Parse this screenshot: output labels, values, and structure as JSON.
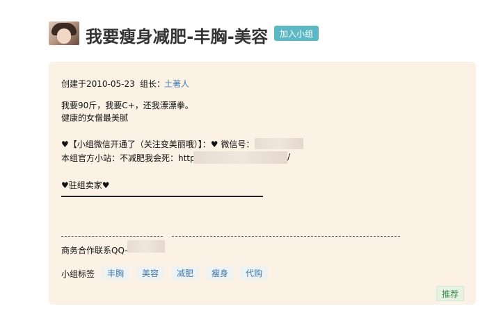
{
  "group": {
    "title": "我要瘦身减肥-丰胸-美容",
    "join_label": "加入小组"
  },
  "info": {
    "created": "创建于2010-05-23",
    "leader_label": "组长：",
    "leader_name": "土著人"
  },
  "description": {
    "line1": "我要90斤，我要C+，还我漂漂拳。",
    "line2": "健康的女僧最美腻",
    "line3": "♥【小组微信开通了（关注变美丽哦）】：♥ 微信号：",
    "line4": "本组官方小站：不减肥我会死：http:",
    "line4_tail": "/",
    "line5": "♥驻组卖家♥",
    "business": "商务合作联系QQ-"
  },
  "tags": {
    "label": "小组标签",
    "items": [
      "丰胸",
      "美容",
      "减肥",
      "瘦身",
      "代购"
    ]
  },
  "recommend_label": "推荐"
}
